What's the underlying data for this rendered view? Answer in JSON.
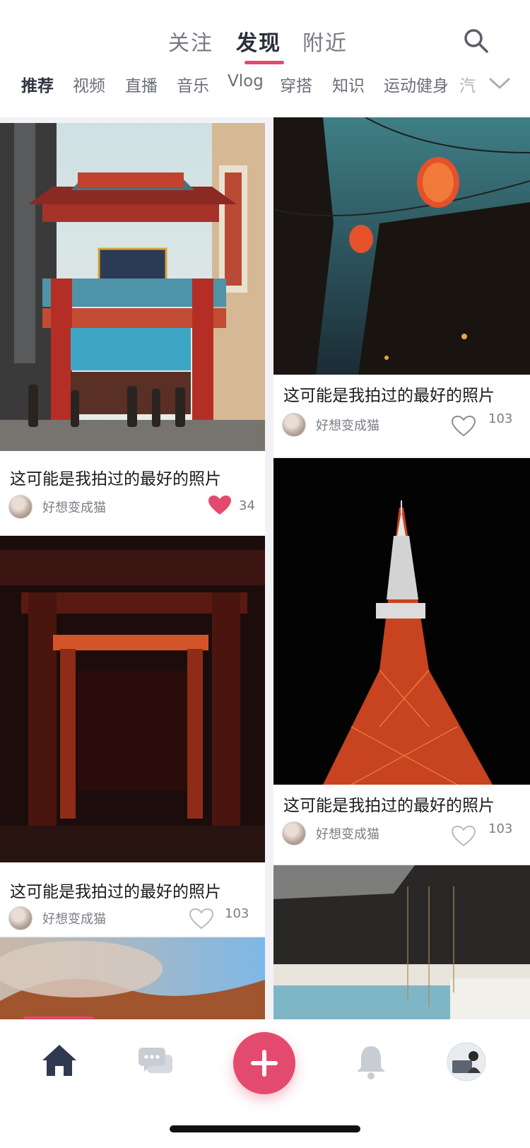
{
  "header": {
    "tabs": [
      {
        "label": "关注",
        "active": false
      },
      {
        "label": "发现",
        "active": true
      },
      {
        "label": "附近",
        "active": false
      }
    ],
    "search_icon": "search-icon",
    "categories": [
      "推荐",
      "视频",
      "直播",
      "音乐",
      "Vlog",
      "穿搭",
      "知识",
      "运动健身",
      "汽"
    ],
    "categories_active": "推荐",
    "more_icon": "chevron-down-icon"
  },
  "feed": {
    "left": [
      {
        "title": "这可能是我拍过的最好的照片",
        "author": "好想变成猫",
        "likes": "34",
        "liked": true,
        "image": "chinatown-gate"
      },
      {
        "title": "这可能是我拍过的最好的照片",
        "author": "好想变成猫",
        "likes": "103",
        "liked": false,
        "image": "red-torii-tunnel"
      },
      {
        "title": "",
        "author": "",
        "likes": "",
        "liked": false,
        "image": "mountain-clouds"
      }
    ],
    "right": [
      {
        "title": "这可能是我拍过的最好的照片",
        "author": "好想变成猫",
        "likes": "103",
        "liked": false,
        "image": "red-lanterns"
      },
      {
        "title": "这可能是我拍过的最好的照片",
        "author": "好想变成猫",
        "likes": "103",
        "liked": false,
        "image": "tokyo-tower"
      },
      {
        "title": "",
        "author": "",
        "likes": "",
        "liked": false,
        "image": "industrial-interior"
      }
    ]
  },
  "bottom_nav": {
    "items": [
      "home-icon",
      "messages-icon",
      "add-icon",
      "bell-icon",
      "profile-avatar"
    ]
  },
  "colors": {
    "accent": "#e44a6d",
    "text": "#1a1a1a",
    "muted": "#7b7e86"
  }
}
